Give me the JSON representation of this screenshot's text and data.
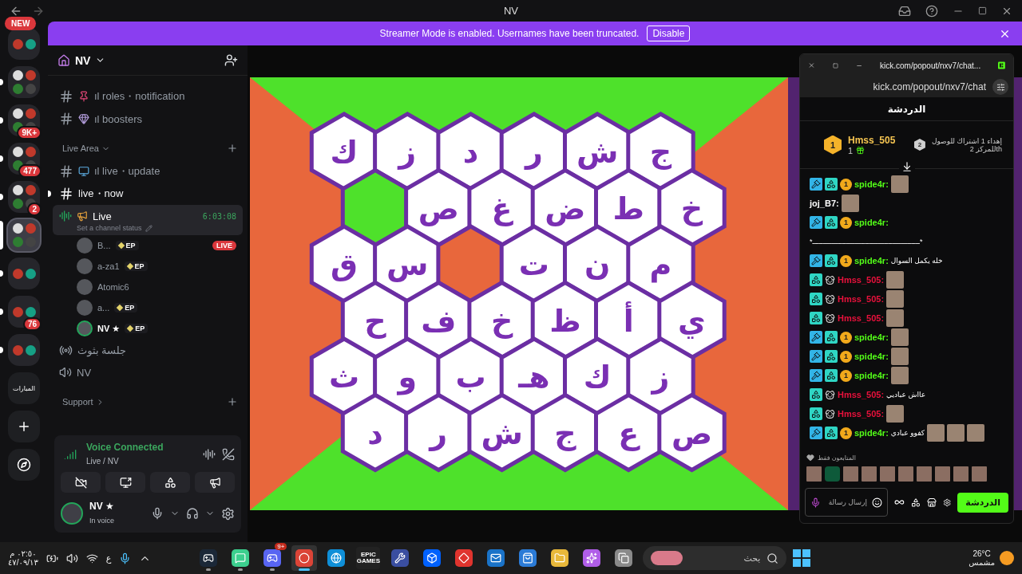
{
  "titlebar": {
    "title": "NV"
  },
  "banner": {
    "text": "Streamer Mode is enabled. Usernames have been truncated.",
    "button": "Disable"
  },
  "server_rail": {
    "new_badge": "NEW",
    "servers": [
      {
        "kind": "server",
        "unread": false,
        "selected": false
      },
      {
        "kind": "folder",
        "unread": true,
        "selected": false
      },
      {
        "kind": "folder",
        "badge": "9K+",
        "unread": true,
        "selected": false
      },
      {
        "kind": "folder",
        "badge": "477",
        "unread": true,
        "selected": false
      },
      {
        "kind": "folder",
        "badge": "2",
        "unread": true,
        "selected": false
      },
      {
        "kind": "folder",
        "unread": false,
        "selected": true
      },
      {
        "kind": "server",
        "unread": true,
        "selected": false
      },
      {
        "kind": "server",
        "badge": "76",
        "unread": true,
        "selected": false
      },
      {
        "kind": "server",
        "unread": true,
        "selected": false
      },
      {
        "kind": "text",
        "label": "المبارات",
        "unread": false,
        "selected": false
      }
    ]
  },
  "server_header": {
    "name": "NV"
  },
  "channels": [
    {
      "kind": "text",
      "name": "ıl roles・notification",
      "unread": false
    },
    {
      "kind": "text",
      "name": "ıl boosters",
      "unread": false
    },
    {
      "kind": "category",
      "name": "Live Area",
      "expanded": true
    },
    {
      "kind": "text",
      "name": "ıl live・update",
      "unread": false
    },
    {
      "kind": "text",
      "name": "live・now",
      "unread": true
    },
    {
      "kind": "voice",
      "name": "Live",
      "timer": "6:03:08",
      "status": "Set a channel status",
      "selected": true,
      "children": [
        {
          "name": "B...",
          "tag": "EP",
          "live": "LIVE",
          "speaking": false
        },
        {
          "name": "a-za1",
          "tag": "EP",
          "speaking": false
        },
        {
          "name": "Atomic6",
          "speaking": false
        },
        {
          "name": "a...",
          "tag": "EP",
          "speaking": false
        },
        {
          "name": "NV ★",
          "tag": "EP",
          "speaking": true
        }
      ]
    },
    {
      "kind": "stage",
      "name": "جلسة بثوث",
      "selected": false
    },
    {
      "kind": "voice",
      "name": "NV",
      "selected": false
    },
    {
      "kind": "category",
      "name": "Support",
      "expanded": false
    }
  ],
  "voice_panel": {
    "title": "Voice Connected",
    "channel": "Live / NV"
  },
  "user_panel": {
    "name": "NV ★",
    "status": "In voice"
  },
  "board": {
    "rows": [
      [
        {
          "letter": "ك"
        },
        {
          "letter": "ز"
        },
        {
          "letter": "د"
        },
        {
          "letter": "ر"
        },
        {
          "letter": "ش"
        },
        {
          "letter": "ج"
        }
      ],
      [
        {
          "color": "#4ee12b"
        },
        {
          "letter": "ص"
        },
        {
          "letter": "غ"
        },
        {
          "letter": "ض"
        },
        {
          "letter": "ط"
        },
        {
          "letter": "خ"
        }
      ],
      [
        {
          "letter": "ق"
        },
        {
          "letter": "س"
        },
        {
          "color": "#e8673c"
        },
        {
          "letter": "ت"
        },
        {
          "letter": "ن"
        },
        {
          "letter": "م"
        }
      ],
      [
        {
          "letter": "ح"
        },
        {
          "letter": "ف"
        },
        {
          "letter": "خ"
        },
        {
          "letter": "ظ"
        },
        {
          "letter": "أ"
        },
        {
          "letter": "ي"
        }
      ],
      [
        {
          "letter": "ث"
        },
        {
          "letter": "و"
        },
        {
          "letter": "ب"
        },
        {
          "letter": "هـ"
        },
        {
          "letter": "ك"
        },
        {
          "letter": "ز"
        }
      ],
      [
        {
          "letter": "د"
        },
        {
          "letter": "ر"
        },
        {
          "letter": "ش"
        },
        {
          "letter": "ج"
        },
        {
          "letter": "ع"
        },
        {
          "letter": "ص"
        }
      ]
    ]
  },
  "chat_popup": {
    "tab_title": "kick.com/popout/nxv7/chat...",
    "address": "kick.com/popout/nxv7/chat",
    "header": "الدردشة",
    "leader": {
      "rank": "1",
      "name": "Hmss_505",
      "count": "1",
      "goal_rank": "2",
      "goal_lines": [
        "إهداء 1 اشتراك للوصول",
        "للمركز 2th"
      ]
    },
    "messages": [
      {
        "user": "spide4r:",
        "color": "#53fc18",
        "badges": [
          {
            "kind": "mod"
          },
          {
            "kind": "og"
          },
          {
            "kind": "sub",
            "label": "1"
          }
        ],
        "emotes": [
          {
            "kind": "image"
          }
        ]
      },
      {
        "user": "joj_B7:",
        "color": "#ffffff",
        "emotes": [
          {
            "kind": "image"
          }
        ]
      },
      {
        "user": "spide4r:",
        "color": "#53fc18",
        "badges": [
          {
            "kind": "mod"
          },
          {
            "kind": "og"
          },
          {
            "kind": "sub",
            "label": "1"
          }
        ]
      },
      {
        "text": "*ـــــــــــــــــــــــــــــــــــــــــــــــــــ*"
      },
      {
        "user": "spide4r:",
        "color": "#53fc18",
        "badges": [
          {
            "kind": "mod"
          },
          {
            "kind": "og"
          },
          {
            "kind": "sub",
            "label": "1"
          }
        ],
        "text": "خله يكمل السوال"
      },
      {
        "user": "Hmss_505:",
        "color": "#e9113c",
        "badges": [
          {
            "kind": "og"
          },
          {
            "kind": "gifter"
          }
        ],
        "emotes": [
          {
            "kind": "image"
          }
        ]
      },
      {
        "user": "Hmss_505:",
        "color": "#e9113c",
        "badges": [
          {
            "kind": "og"
          },
          {
            "kind": "gifter"
          }
        ],
        "emotes": [
          {
            "kind": "image"
          }
        ]
      },
      {
        "user": "Hmss_505:",
        "color": "#e9113c",
        "badges": [
          {
            "kind": "og"
          },
          {
            "kind": "gifter"
          }
        ],
        "emotes": [
          {
            "kind": "image"
          }
        ]
      },
      {
        "user": "spide4r:",
        "color": "#53fc18",
        "badges": [
          {
            "kind": "mod"
          },
          {
            "kind": "og"
          },
          {
            "kind": "sub",
            "label": "1"
          }
        ],
        "emotes": [
          {
            "kind": "image"
          }
        ]
      },
      {
        "user": "spide4r:",
        "color": "#53fc18",
        "badges": [
          {
            "kind": "mod"
          },
          {
            "kind": "og"
          },
          {
            "kind": "sub",
            "label": "1"
          }
        ],
        "emotes": [
          {
            "kind": "image"
          }
        ]
      },
      {
        "user": "spide4r:",
        "color": "#53fc18",
        "badges": [
          {
            "kind": "mod"
          },
          {
            "kind": "og"
          },
          {
            "kind": "sub",
            "label": "1"
          }
        ],
        "emotes": [
          {
            "kind": "image"
          }
        ]
      },
      {
        "user": "Hmss_505:",
        "color": "#e9113c",
        "badges": [
          {
            "kind": "og"
          },
          {
            "kind": "gifter"
          }
        ],
        "text": "عااش عباديي"
      },
      {
        "user": "Hmss_505:",
        "color": "#e9113c",
        "badges": [
          {
            "kind": "og"
          },
          {
            "kind": "gifter"
          }
        ],
        "emotes": [
          {
            "kind": "image"
          }
        ]
      },
      {
        "user": "spide4r:",
        "color": "#53fc18",
        "badges": [
          {
            "kind": "mod"
          },
          {
            "kind": "og"
          },
          {
            "kind": "sub",
            "label": "1"
          }
        ],
        "text": "كفوو عبادي",
        "emotes": [
          {
            "kind": "image"
          },
          {
            "kind": "image"
          },
          {
            "kind": "image"
          }
        ]
      }
    ],
    "followers_only": "المتابعون فقط",
    "emote_bar": [
      {
        "kind": "image"
      },
      {
        "kind": "logo"
      },
      {
        "kind": "image"
      },
      {
        "kind": "image"
      },
      {
        "kind": "image"
      },
      {
        "kind": "image"
      },
      {
        "kind": "image"
      },
      {
        "kind": "image"
      },
      {
        "kind": "image"
      },
      {
        "kind": "image"
      }
    ],
    "input_placeholder": "إرسال رسالة",
    "send_button": "الدردشة"
  },
  "taskbar": {
    "time": "٠٢:٥٠ م",
    "date": "٤٧/٠٩/١٣",
    "language": "ع",
    "apps": [
      {
        "kind": "steam",
        "running": true,
        "selected": false
      },
      {
        "kind": "green",
        "running": true,
        "selected": false
      },
      {
        "kind": "discord",
        "badge": "9+",
        "running": true,
        "selected": false
      },
      {
        "kind": "chrome",
        "running": true,
        "selected": true
      },
      {
        "kind": "edge",
        "running": false,
        "selected": false
      },
      {
        "kind": "epic",
        "label": "EPIC GAMES",
        "running": false,
        "selected": false
      },
      {
        "kind": "tool",
        "running": false,
        "selected": false
      },
      {
        "kind": "dropbox",
        "running": false,
        "selected": false
      },
      {
        "kind": "diamond",
        "running": false,
        "selected": false
      },
      {
        "kind": "mail",
        "running": false,
        "selected": false
      },
      {
        "kind": "store",
        "running": false,
        "selected": false
      },
      {
        "kind": "folder",
        "running": false,
        "selected": false
      },
      {
        "kind": "copilot",
        "running": false,
        "selected": false
      },
      {
        "kind": "windows",
        "running": false,
        "selected": false
      }
    ],
    "search_placeholder": "بحث",
    "weather": {
      "temp": "26°C",
      "condition": "مشمس"
    }
  }
}
